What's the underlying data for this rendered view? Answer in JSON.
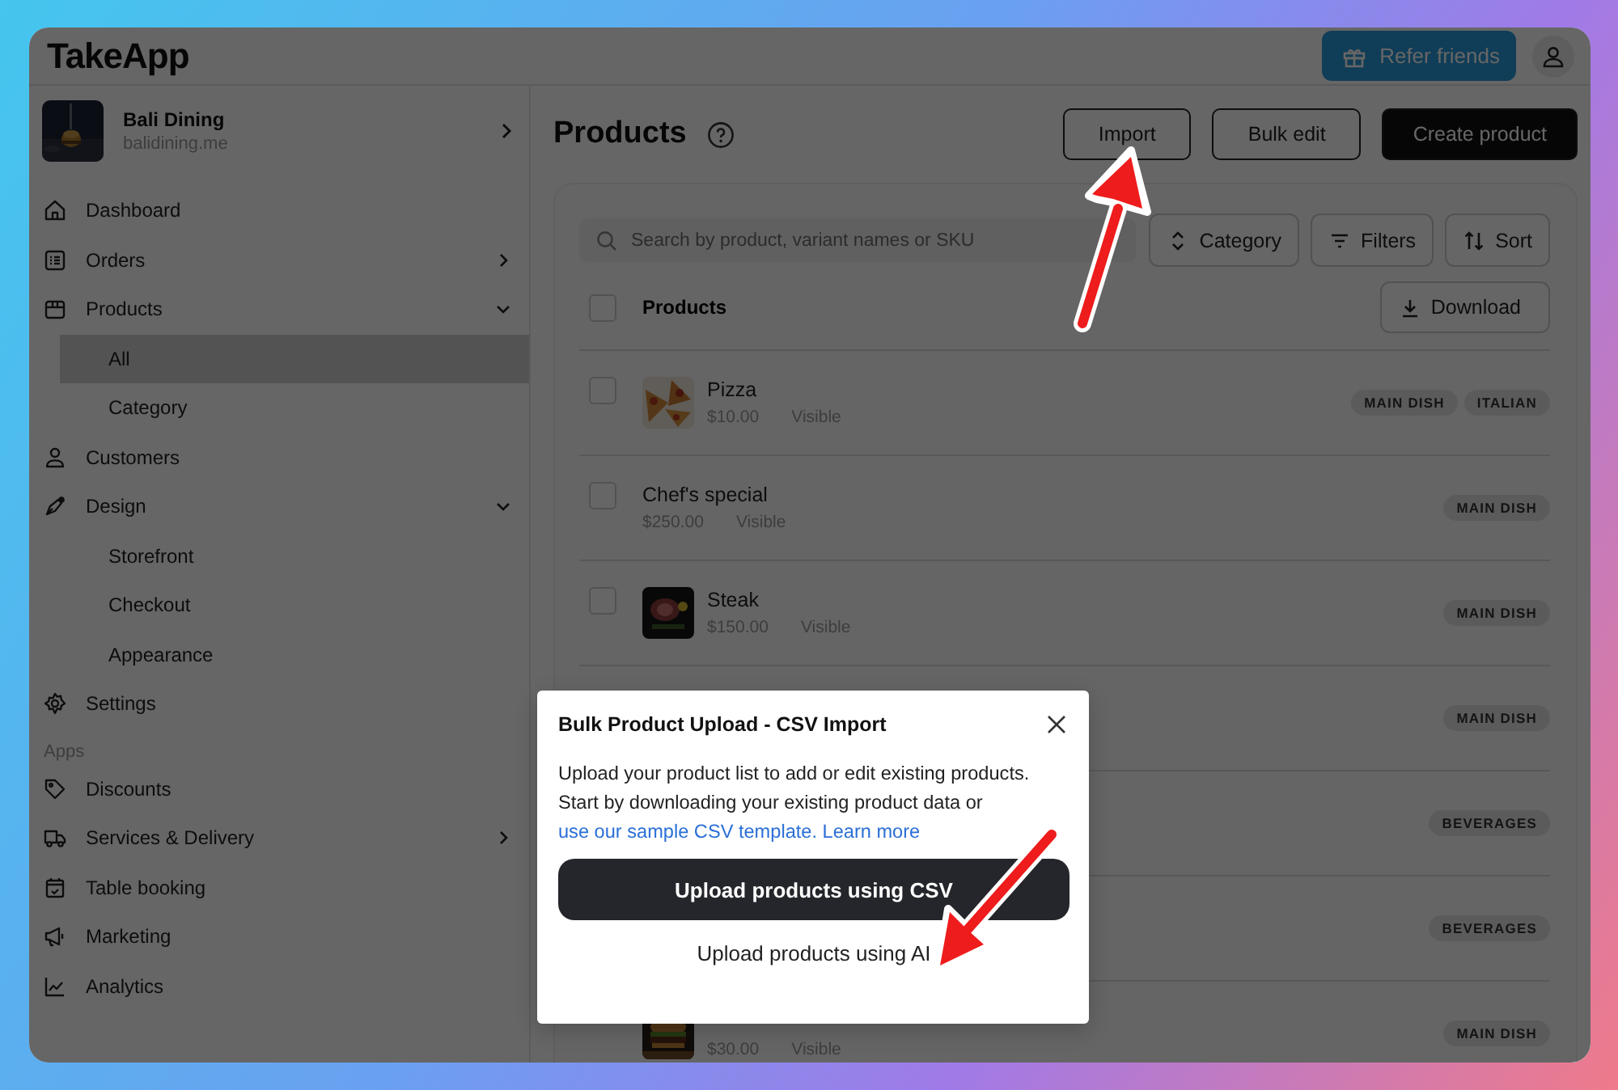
{
  "header": {
    "logo": "TakeApp",
    "refer_button": "Refer friends"
  },
  "store": {
    "name": "Bali Dining",
    "domain": "balidining.me",
    "avatar": {
      "kind": "picture"
    }
  },
  "sidebar": {
    "items": [
      {
        "kind": "link",
        "label": "Dashboard",
        "selected": false
      },
      {
        "kind": "group",
        "label": "Orders",
        "expanded": false,
        "selected": false
      },
      {
        "kind": "group",
        "label": "Products",
        "expanded": true,
        "selected": false
      },
      {
        "kind": "sub",
        "label": "All",
        "selected": true
      },
      {
        "kind": "sub",
        "label": "Category",
        "selected": false
      },
      {
        "kind": "link",
        "label": "Customers",
        "selected": false
      },
      {
        "kind": "group",
        "label": "Design",
        "expanded": true,
        "selected": false
      },
      {
        "kind": "sub",
        "label": "Storefront",
        "selected": false
      },
      {
        "kind": "sub",
        "label": "Checkout",
        "selected": false
      },
      {
        "kind": "sub",
        "label": "Appearance",
        "selected": false
      },
      {
        "kind": "link",
        "label": "Settings",
        "selected": false
      },
      {
        "kind": "heading",
        "label": "Apps"
      },
      {
        "kind": "link",
        "label": "Discounts",
        "selected": false
      },
      {
        "kind": "group",
        "label": "Services & Delivery",
        "expanded": false,
        "selected": false
      },
      {
        "kind": "link",
        "label": "Table booking",
        "selected": false
      },
      {
        "kind": "link",
        "label": "Marketing",
        "selected": false
      },
      {
        "kind": "link",
        "label": "Analytics",
        "selected": false
      }
    ]
  },
  "page": {
    "title": "Products",
    "buttons": [
      {
        "label": "Import",
        "kind": "outline"
      },
      {
        "label": "Bulk edit",
        "kind": "outline"
      },
      {
        "label": "Create product",
        "kind": "primary"
      }
    ]
  },
  "toolbar": {
    "search": {
      "placeholder": "Search by product, variant names or SKU"
    },
    "buttons": [
      "Category",
      "Filters",
      "Sort"
    ]
  },
  "table": {
    "column": "Products",
    "select_all_checked": false,
    "download": "Download",
    "rows": [
      {
        "checked": false,
        "name": "Pizza",
        "price": "$10.00",
        "status": "Visible",
        "image": {
          "kind": "picture"
        },
        "tags": [
          "MAIN DISH",
          "ITALIAN"
        ]
      },
      {
        "checked": false,
        "name": "Chef's special",
        "price": "$250.00",
        "status": "Visible",
        "tags": [
          "MAIN DISH"
        ]
      },
      {
        "checked": false,
        "name": "Steak",
        "price": "$150.00",
        "status": "Visible",
        "image": {
          "kind": "picture"
        },
        "tags": [
          "MAIN DISH"
        ]
      },
      {
        "tags": [
          "MAIN DISH"
        ]
      },
      {
        "tags": [
          "BEVERAGES"
        ]
      },
      {
        "tags": [
          "BEVERAGES"
        ]
      },
      {
        "price": "$30.00",
        "status": "Visible",
        "image": {
          "kind": "picture"
        },
        "tags": [
          "MAIN DISH"
        ]
      }
    ]
  },
  "modal": {
    "title": "Bulk Product Upload - CSV Import",
    "text": "Upload your product list to add or edit existing products. Start by downloading your existing product data or",
    "links": [
      "use our sample CSV template.",
      "Learn more"
    ],
    "primary_button": "Upload products using CSV",
    "secondary_button": "Upload products using AI"
  }
}
